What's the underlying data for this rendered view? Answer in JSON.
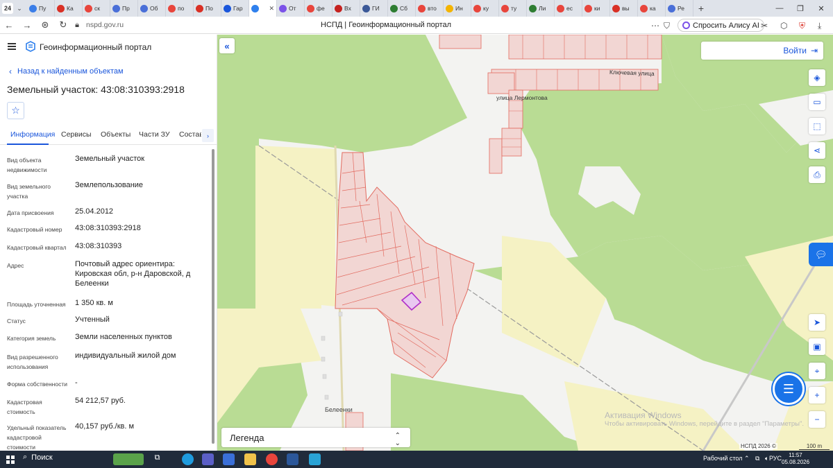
{
  "browser": {
    "tab_count": "24",
    "tabs": [
      {
        "label": "Пу",
        "color": "#3b7ee8"
      },
      {
        "label": "Ка",
        "color": "#d93025"
      },
      {
        "label": "ск",
        "color": "#e8453c"
      },
      {
        "label": "Пр",
        "color": "#4a6fd8"
      },
      {
        "label": "Об",
        "color": "#4a6fd8"
      },
      {
        "label": "по",
        "color": "#e8453c"
      },
      {
        "label": "По",
        "color": "#d93025"
      },
      {
        "label": "Гар",
        "color": "#1a56db"
      },
      {
        "label": "",
        "color": "#2f80ed",
        "active": true
      },
      {
        "label": "От",
        "color": "#7b52e8"
      },
      {
        "label": "фе",
        "color": "#e8453c"
      },
      {
        "label": "Вх",
        "color": "#c5221f"
      },
      {
        "label": "ГИ",
        "color": "#3b5998"
      },
      {
        "label": "Сб",
        "color": "#2e7d32"
      },
      {
        "label": "вто",
        "color": "#e8453c"
      },
      {
        "label": "Ин",
        "color": "#f4b400"
      },
      {
        "label": "ку",
        "color": "#e8453c"
      },
      {
        "label": "ту",
        "color": "#e8453c"
      },
      {
        "label": "Ли",
        "color": "#2e7d32"
      },
      {
        "label": "ес",
        "color": "#e8453c"
      },
      {
        "label": "ки",
        "color": "#e8453c"
      },
      {
        "label": "вы",
        "color": "#d93025"
      },
      {
        "label": "ка",
        "color": "#e8453c"
      },
      {
        "label": "Ре",
        "color": "#4a6fd8"
      }
    ],
    "url": "nspd.gov.ru",
    "page_title": "НСПД | Геоинформационный портал",
    "alice_label": "Спросить Алису AI"
  },
  "sidebar": {
    "app_title": "Геоинформационный портал",
    "back_label": "Назад к найденным объектам",
    "object_title": "Земельный участок: 43:08:310393:2918",
    "tabs": [
      "Информация",
      "Сервисы",
      "Объекты",
      "Части ЗУ",
      "Состав"
    ],
    "properties": [
      {
        "label": "Вид объекта недвижимости",
        "value": "Земельный участок"
      },
      {
        "label": "Вид земельного участка",
        "value": "Землепользование"
      },
      {
        "label": "Дата присвоения",
        "value": "25.04.2012"
      },
      {
        "label": "Кадастровый номер",
        "value": "43:08:310393:2918"
      },
      {
        "label": "Кадастровый квартал",
        "value": "43:08:310393"
      },
      {
        "label": "Адрес",
        "value": "Почтовый адрес ориентира: Кировская обл, р-н Даровской, д Белеенки"
      },
      {
        "label": "Площадь уточненная",
        "value": "1 350 кв. м"
      },
      {
        "label": "Статус",
        "value": "Учтенный"
      },
      {
        "label": "Категория земель",
        "value": "Земли населенных пунктов"
      },
      {
        "label": "Вид разрешенного использования",
        "value": "индивидуальный жилой дом"
      },
      {
        "label": "Форма собственности",
        "value": "-"
      },
      {
        "label": "Кадастровая стоимость",
        "value": "54 212,57 руб."
      },
      {
        "label": "Удельный показатель кадастровой стоимости",
        "value": "40,157 руб./кв. м"
      }
    ]
  },
  "map": {
    "login_label": "Войти",
    "legend_label": "Легенда",
    "streets": [
      "Ключевая улица",
      "улица Лермонтова"
    ],
    "village": "Белеенки",
    "copyright": "НСПД 2026 ©",
    "scale": "100 m",
    "watermark_title": "Активация Windows",
    "watermark_text": "Чтобы активировать Windows, перейдите в раздел \"Параметры\"."
  },
  "taskbar": {
    "search_label": "Поиск",
    "desktop_label": "Рабочий стол",
    "lang": "РУС",
    "time": "11:57",
    "date": "05.08.2026"
  }
}
